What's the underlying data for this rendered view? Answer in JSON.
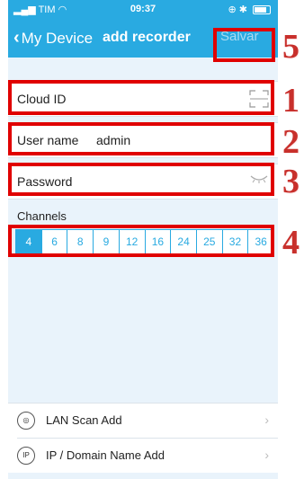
{
  "status_bar": {
    "carrier": "TIM",
    "time": "09:37"
  },
  "nav": {
    "back_label": "My Device",
    "title": "add recorder",
    "save_label": "Salvar"
  },
  "fields": {
    "cloud_id": {
      "label": "Cloud ID",
      "value": ""
    },
    "username": {
      "label": "User name",
      "value": "admin"
    },
    "password": {
      "label": "Password",
      "value": ""
    }
  },
  "channels": {
    "label": "Channels",
    "options": [
      "4",
      "6",
      "8",
      "9",
      "12",
      "16",
      "24",
      "25",
      "32",
      "36"
    ],
    "selected": "4"
  },
  "bottom_menu": {
    "lan_scan_label": "LAN Scan Add",
    "ip_domain_label": "IP / Domain Name Add",
    "ip_icon_text": "IP"
  },
  "annotations": {
    "n1": "1",
    "n2": "2",
    "n3": "3",
    "n4": "4",
    "n5": "5"
  },
  "colors": {
    "accent": "#29aae1",
    "highlight": "#e00000",
    "annotation_number": "#c8302c"
  }
}
